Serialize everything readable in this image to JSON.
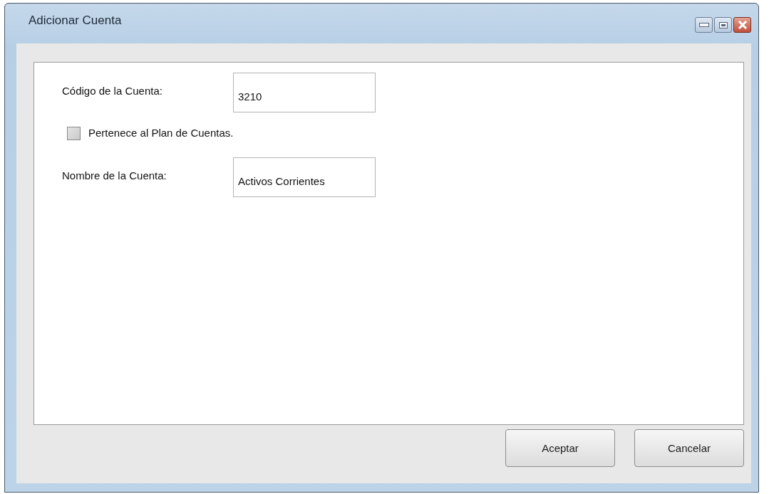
{
  "window": {
    "title": "Adicionar Cuenta"
  },
  "form": [
    {
      "kind": "text",
      "label": "Código de la Cuenta:",
      "value": "3210"
    },
    {
      "kind": "checkbox",
      "label": "Pertenece al Plan de Cuentas.",
      "checked": false
    },
    {
      "kind": "text",
      "label": "Nombre de la Cuenta:",
      "value": "Activos Corrientes"
    }
  ],
  "buttons": [
    "Aceptar",
    "Cancelar"
  ]
}
